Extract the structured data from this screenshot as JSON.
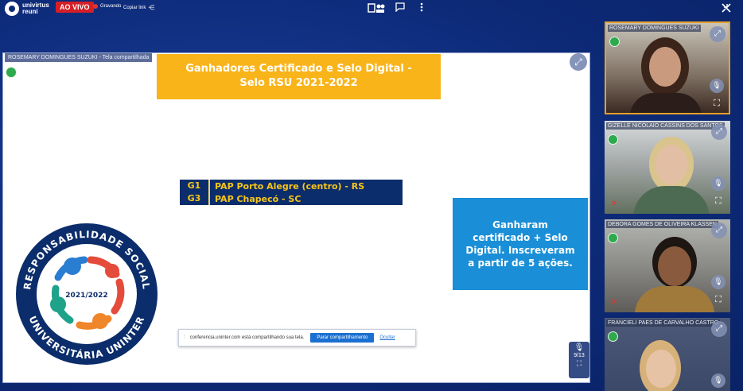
{
  "brand": {
    "line1": "univirtus",
    "line2": "reuni"
  },
  "live_label": "AO VIVO",
  "recording_label": "Gravando",
  "copy_link_label": "Copiar link",
  "share": {
    "label": "ROSEMARY DOMINGUES SUZUKI - Tela compartilhada",
    "slide": {
      "title_line1": "Ganhadores Certificado e Selo Digital -",
      "title_line2": "Selo RSU 2021-2022",
      "rows": [
        {
          "code": "G1",
          "name": "PAP Porto Alegre (centro) - RS"
        },
        {
          "code": "G3",
          "name": "PAP Chapecó - SC"
        }
      ],
      "box_lines": [
        "Ganharam",
        "certificado + Selo",
        "Digital. Inscreveram",
        "a partir de 5 ações."
      ],
      "seal": {
        "top_text": "RESPONSABILIDADE SOCIAL",
        "bottom_text": "UNIVERSITÁRIA UNINTER",
        "year": "2021/2022"
      }
    },
    "page_indicator": "9/13"
  },
  "notification": {
    "message": "conferencia.uninter.com está compartilhando sua tela.",
    "stop_label": "Parar compartilhamento",
    "hide_label": "Ocultar"
  },
  "participants": [
    {
      "name": "ROSEMARY DOMINGUES SUZUKI"
    },
    {
      "name": "GIZELLE NICOLAIO CASSINS DOS SANTOS"
    },
    {
      "name": "DEBORA GOMES DE OLIVEIRA KLASSEN"
    },
    {
      "name": "FRANCIELI PAES DE CARVALHO CASTRO"
    }
  ],
  "colors": {
    "accent_orange": "#f9b41a",
    "slide_blue": "#1a8fd7",
    "live_red": "#d51f26"
  }
}
